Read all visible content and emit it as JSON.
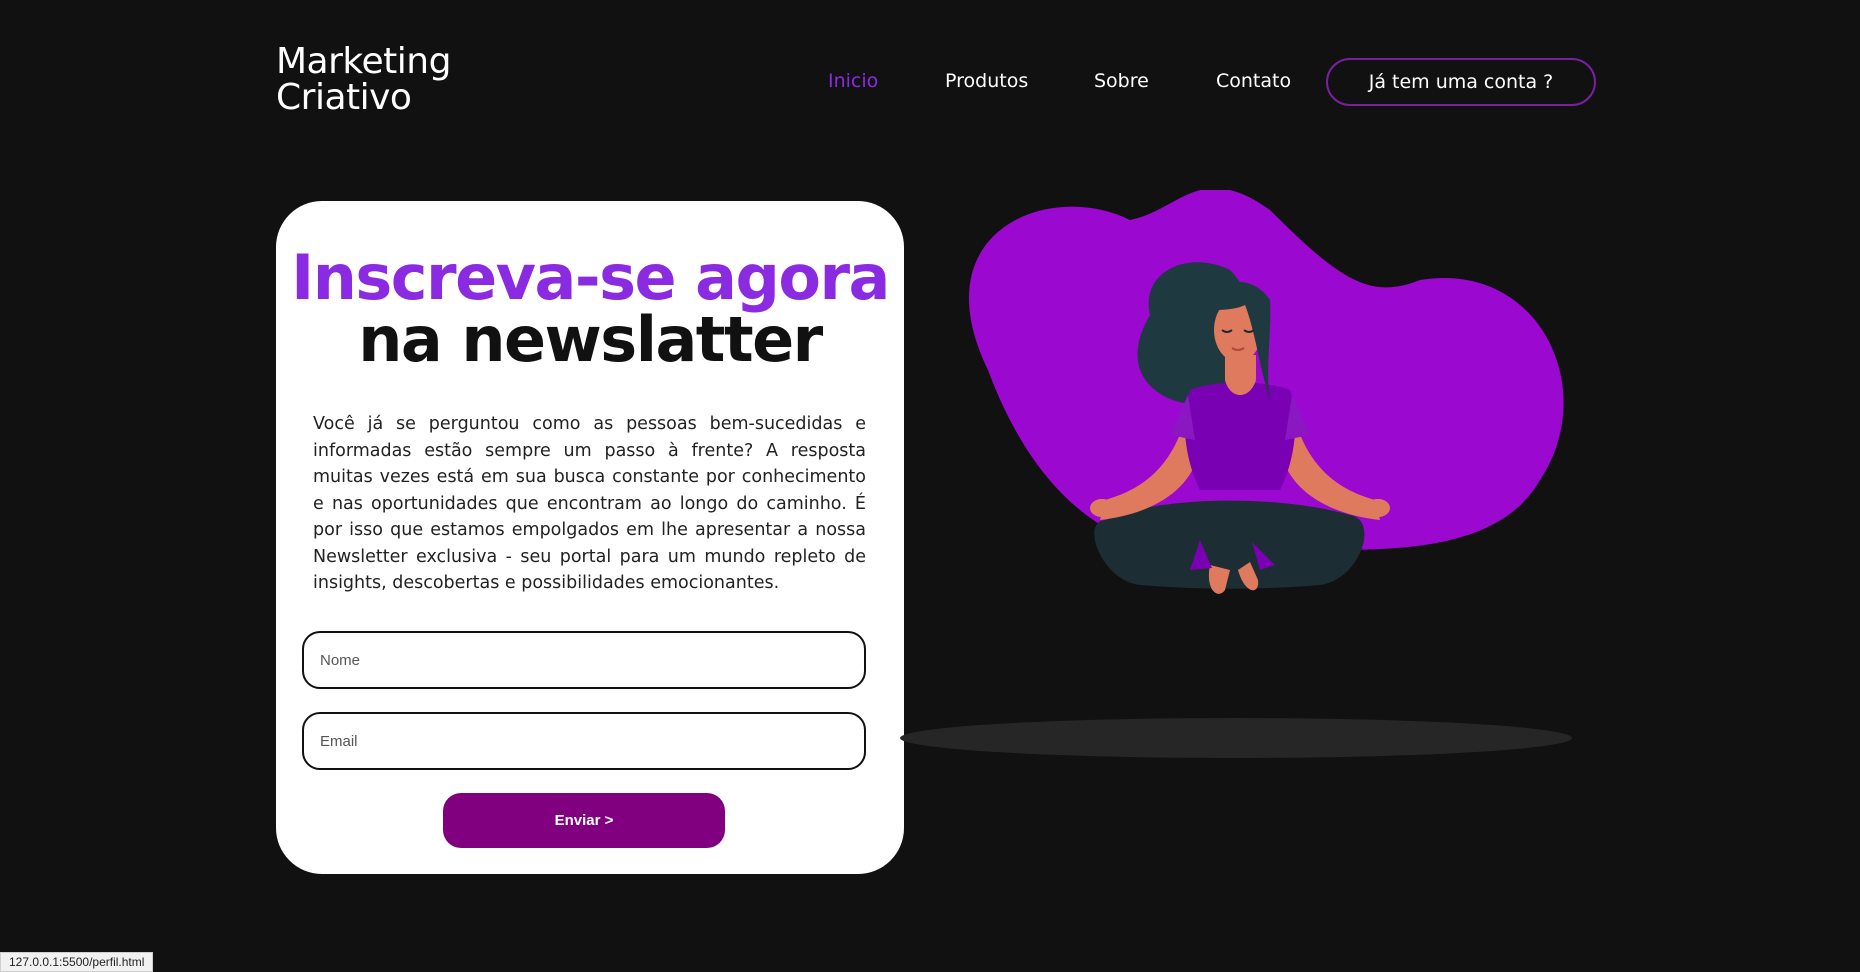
{
  "header": {
    "logo_line1": "Marketing",
    "logo_line2": "Criativo",
    "nav": [
      "Inicio",
      "Produtos",
      "Sobre",
      "Contato"
    ],
    "account_button": "Já tem uma conta ?"
  },
  "card": {
    "title_line1": "Inscreva-se agora",
    "title_line2": "na newslatter",
    "description": "Você já se perguntou como as pessoas bem-sucedidas e informadas estão sempre um passo à frente? A resposta muitas vezes está em sua busca constante por conhecimento e nas oportunidades que encontram ao longo do caminho. É por isso que estamos empolgados em lhe apresentar a nossa Newsletter exclusiva - seu portal para um mundo repleto de insights, descobertas e possibilidades emocionantes.",
    "name_placeholder": "Nome",
    "email_placeholder": "Email",
    "submit_label": "Enviar >"
  },
  "status_bar": {
    "url": "127.0.0.1:5500/perfil.html"
  },
  "colors": {
    "background": "#111111",
    "accent": "#8a2be2",
    "button": "#800080",
    "blob": "#9b08d0"
  }
}
